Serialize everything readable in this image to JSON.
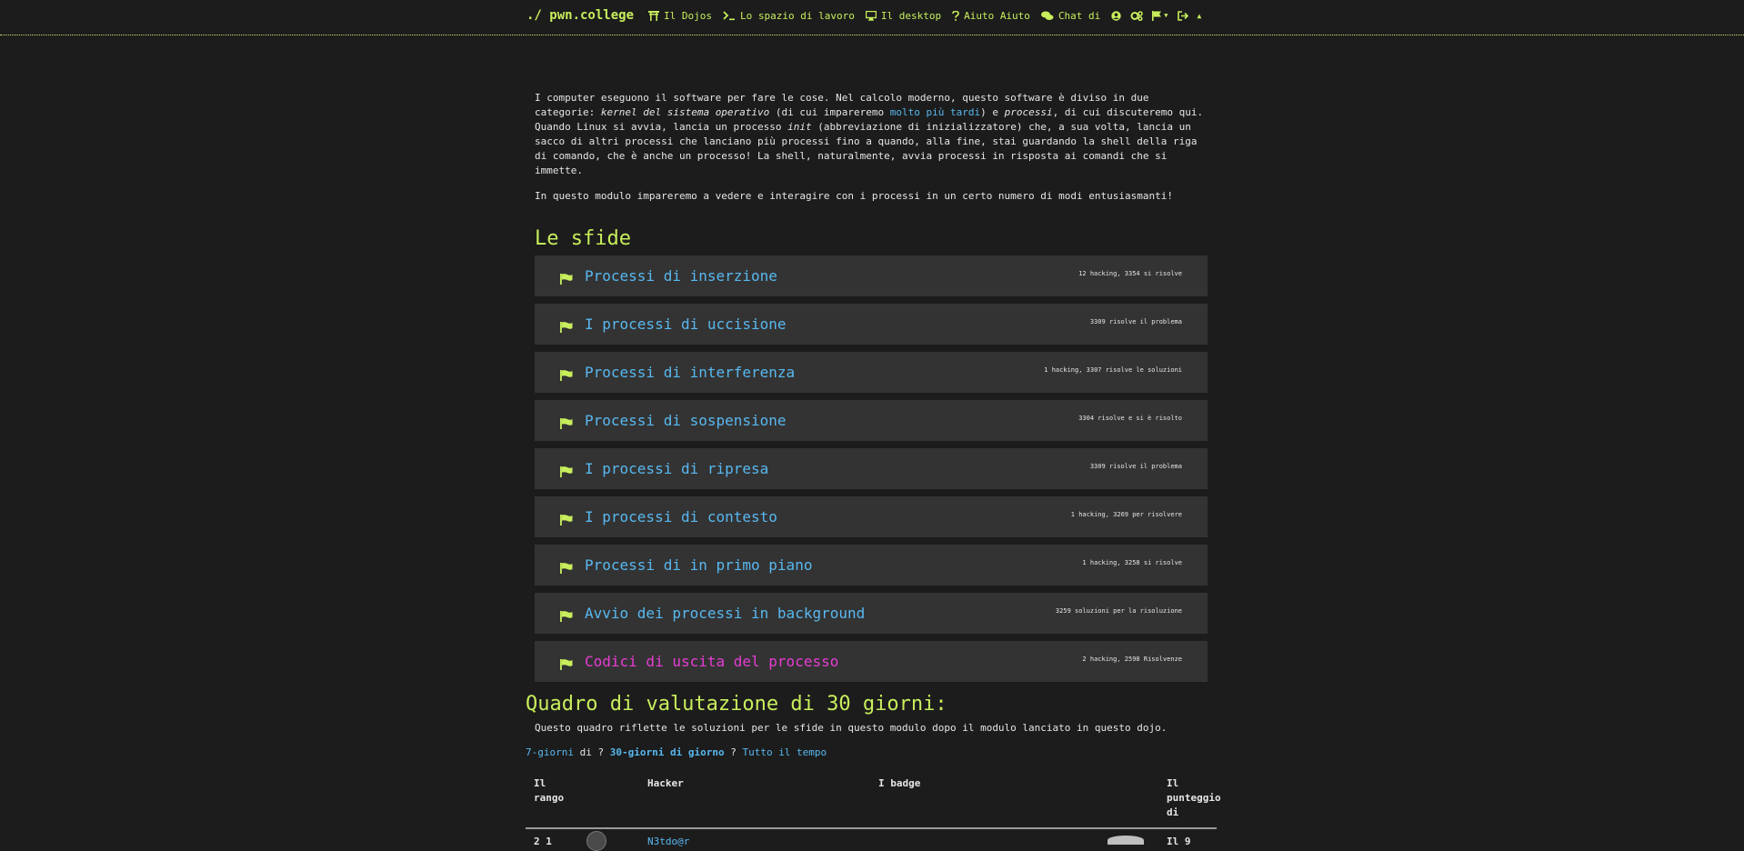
{
  "nav": {
    "brand": "./ pwn.college",
    "items": [
      {
        "label": "Il Dojos",
        "icon": "torii-gate-icon"
      },
      {
        "label": "Lo spazio di lavoro",
        "icon": "terminal-icon"
      },
      {
        "label": "Il desktop",
        "icon": "desktop-icon"
      },
      {
        "label": "Aiuto Aiuto",
        "icon": "question-icon"
      },
      {
        "label": "Chat di",
        "icon": "comments-icon"
      }
    ],
    "icons": [
      "user-circle-icon",
      "gear-icon",
      "flag-menu-icon",
      "sign-out-icon",
      "caret-up-icon"
    ]
  },
  "intro": {
    "p1_a": "I computer eseguono il software per fare le cose. Nel calcolo moderno, questo software è diviso in due categorie: ",
    "p1_em1": "kernel del sistema operativo",
    "p1_b": " (di cui impareremo ",
    "p1_link": "molto più tardi",
    "p1_c": ") e ",
    "p1_em2": "processi",
    "p1_d": ", di cui discuteremo qui. Quando Linux si avvia, lancia un processo ",
    "p1_em3": "init",
    "p1_e": " (abbreviazione di inizializzatore) che, a sua volta, lancia un sacco di altri processi che lanciano più processi fino a quando, alla fine, stai guardando la shell della riga di comando, che è anche un processo! La shell, naturalmente, avvia processi in risposta ai comandi che si immette.",
    "p2": "In questo modulo impareremo a vedere e interagire con i processi in un certo numero di modi entusiasmanti!"
  },
  "challenges_title": "Le sfide",
  "challenges": [
    {
      "name": "Processi di inserzione",
      "stats": "12 hacking, 3354 si risolve",
      "active": false
    },
    {
      "name": "I processi di uccisione",
      "stats": "3309 risolve il problema",
      "active": false
    },
    {
      "name": "Processi di interferenza",
      "stats": "1 hacking, 3307 risolve le soluzioni",
      "active": false
    },
    {
      "name": "Processi di sospensione",
      "stats": "3304 risolve e si è risolto",
      "active": false
    },
    {
      "name": "I processi di ripresa",
      "stats": "3309 risolve il problema",
      "active": false
    },
    {
      "name": "I processi di contesto",
      "stats": "1 hacking, 3269 per risolvere",
      "active": false
    },
    {
      "name": "Processi di in primo piano",
      "stats": "1 hacking, 3258 si risolve",
      "active": false
    },
    {
      "name": "Avvio dei processi in background",
      "stats": "3259 soluzioni per la risoluzione",
      "active": false
    },
    {
      "name": "Codici di uscita del processo",
      "stats": "2 hacking, 2598 Risolvenze",
      "active": true
    }
  ],
  "scoreboard": {
    "title": "Quadro di valutazione di 30 giorni:",
    "desc": "Questo quadro riflette le soluzioni per le sfide in questo modulo dopo il modulo lanciato in questo dojo.",
    "tab_7": "7-giorni",
    "sep1": " di ? ",
    "tab_30": "30-giorni di giorno",
    "sep2": " ? ",
    "tab_all": "Tutto il tempo",
    "headers": {
      "rank": "Il rango",
      "hacker": "Hacker",
      "badges": "I badge",
      "score": "Il punteggio di"
    },
    "first_row": {
      "rank": "2 1",
      "hacker": "N3tdo@r",
      "score": "Il 9"
    }
  },
  "colors": {
    "accent_green": "#c8ee5c",
    "link_blue": "#58b8f0",
    "active_magenta": "#e83cd4",
    "card_bg": "#333333",
    "page_bg": "#1c1c1c"
  }
}
